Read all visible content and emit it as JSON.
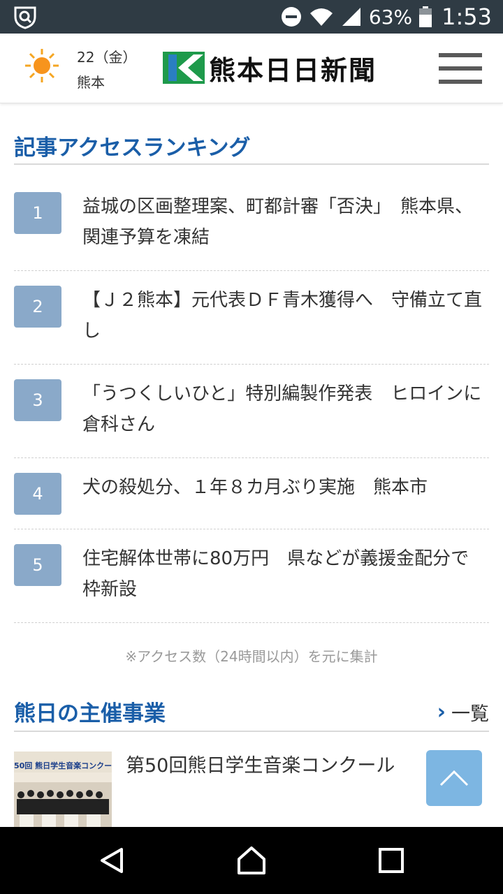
{
  "status_bar": {
    "battery": "63%",
    "time": "1:53",
    "icons": [
      "shield-icon",
      "dnd-icon",
      "wifi-icon",
      "signal-icon",
      "battery-icon"
    ]
  },
  "header": {
    "weather_date": "22（金）",
    "weather_city": "熊本",
    "weather_icon": "sun-icon",
    "logo_text": "熊本日日新聞",
    "menu_icon": "hamburger-menu-icon"
  },
  "ranking": {
    "title": "記事アクセスランキング",
    "items": [
      {
        "rank": "1",
        "title": "益城の区画整理案、町都計審「否決」　熊本県、関連予算を凍結"
      },
      {
        "rank": "2",
        "title": "【Ｊ２熊本】元代表ＤＦ青木獲得へ　守備立て直し"
      },
      {
        "rank": "3",
        "title": "「うつくしいひと」特別編製作発表　ヒロインに倉科さん"
      },
      {
        "rank": "4",
        "title": "犬の殺処分、１年８カ月ぶり実施　熊本市"
      },
      {
        "rank": "5",
        "title": "住宅解体世帯に80万円　県などが義援金配分で枠新設"
      }
    ],
    "note": "※アクセス数（24時間以内）を元に集計"
  },
  "events": {
    "title": "熊日の主催事業",
    "more_label": "一覧",
    "items": [
      {
        "title": "第50回熊日学生音楽コンクール",
        "thumb_banner": "50回 熊日学生音楽コンクール"
      }
    ]
  },
  "colors": {
    "accent": "#1a5ea8",
    "rank_badge": "#8aa9c9",
    "to_top": "#7db6e2",
    "status_bar": "#2f3b44"
  }
}
